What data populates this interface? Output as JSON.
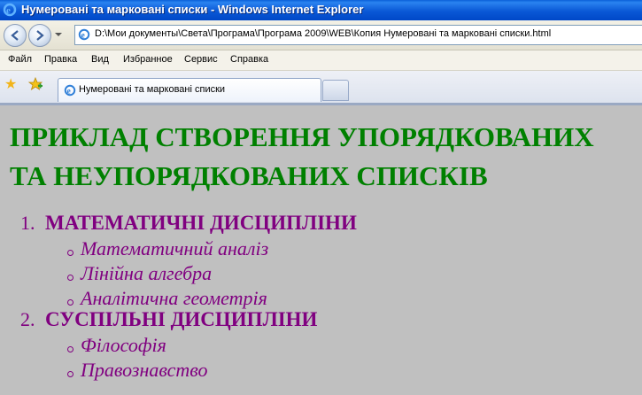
{
  "window": {
    "title": "Нумеровані та марковані списки - Windows Internet Explorer"
  },
  "address_bar": {
    "url": "D:\\Мои документы\\Света\\Програма\\Програма 2009\\WEB\\Копия Нумеровані та марковані списки.html"
  },
  "menu": {
    "items": [
      "Файл",
      "Правка",
      "Вид",
      "Избранное",
      "Сервис",
      "Справка"
    ]
  },
  "tabs": {
    "active_label": "Нумеровані та марковані списки"
  },
  "page": {
    "heading_line1": "ПРИКЛАД СТВОРЕННЯ УПОРЯДКОВАНИХ",
    "heading_line2": "ТА НЕУПОРЯДКОВАНИХ СПИСКІВ",
    "list": [
      {
        "number": "1.",
        "label": "МАТЕМАТИЧНІ ДИСЦИПЛІНИ",
        "items": [
          "Математичний аналіз",
          "Лінійна алгебра",
          "Аналітична геометрія"
        ]
      },
      {
        "number": "2.",
        "label": "СУСПІЛЬНІ ДИСЦИПЛІНИ",
        "items": [
          "Філософія",
          "Правознавство"
        ]
      }
    ]
  },
  "colors": {
    "heading": "#008000",
    "list_text": "#800080",
    "page_background": "#c0c0c0",
    "titlebar": "#0a58d6"
  }
}
